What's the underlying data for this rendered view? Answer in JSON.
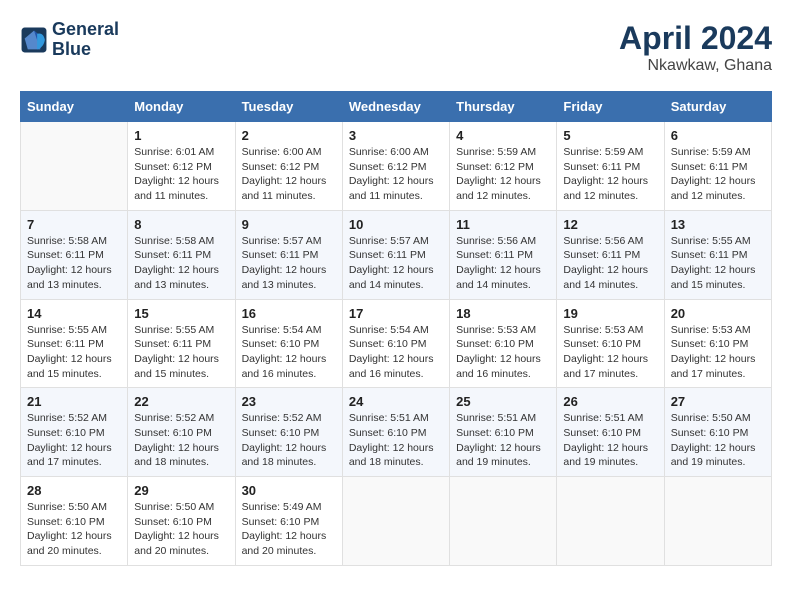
{
  "header": {
    "logo_line1": "General",
    "logo_line2": "Blue",
    "month": "April 2024",
    "location": "Nkawkaw, Ghana"
  },
  "weekdays": [
    "Sunday",
    "Monday",
    "Tuesday",
    "Wednesday",
    "Thursday",
    "Friday",
    "Saturday"
  ],
  "weeks": [
    [
      {
        "day": "",
        "sunrise": "",
        "sunset": "",
        "daylight": ""
      },
      {
        "day": "1",
        "sunrise": "Sunrise: 6:01 AM",
        "sunset": "Sunset: 6:12 PM",
        "daylight": "Daylight: 12 hours and 11 minutes."
      },
      {
        "day": "2",
        "sunrise": "Sunrise: 6:00 AM",
        "sunset": "Sunset: 6:12 PM",
        "daylight": "Daylight: 12 hours and 11 minutes."
      },
      {
        "day": "3",
        "sunrise": "Sunrise: 6:00 AM",
        "sunset": "Sunset: 6:12 PM",
        "daylight": "Daylight: 12 hours and 11 minutes."
      },
      {
        "day": "4",
        "sunrise": "Sunrise: 5:59 AM",
        "sunset": "Sunset: 6:12 PM",
        "daylight": "Daylight: 12 hours and 12 minutes."
      },
      {
        "day": "5",
        "sunrise": "Sunrise: 5:59 AM",
        "sunset": "Sunset: 6:11 PM",
        "daylight": "Daylight: 12 hours and 12 minutes."
      },
      {
        "day": "6",
        "sunrise": "Sunrise: 5:59 AM",
        "sunset": "Sunset: 6:11 PM",
        "daylight": "Daylight: 12 hours and 12 minutes."
      }
    ],
    [
      {
        "day": "7",
        "sunrise": "Sunrise: 5:58 AM",
        "sunset": "Sunset: 6:11 PM",
        "daylight": "Daylight: 12 hours and 13 minutes."
      },
      {
        "day": "8",
        "sunrise": "Sunrise: 5:58 AM",
        "sunset": "Sunset: 6:11 PM",
        "daylight": "Daylight: 12 hours and 13 minutes."
      },
      {
        "day": "9",
        "sunrise": "Sunrise: 5:57 AM",
        "sunset": "Sunset: 6:11 PM",
        "daylight": "Daylight: 12 hours and 13 minutes."
      },
      {
        "day": "10",
        "sunrise": "Sunrise: 5:57 AM",
        "sunset": "Sunset: 6:11 PM",
        "daylight": "Daylight: 12 hours and 14 minutes."
      },
      {
        "day": "11",
        "sunrise": "Sunrise: 5:56 AM",
        "sunset": "Sunset: 6:11 PM",
        "daylight": "Daylight: 12 hours and 14 minutes."
      },
      {
        "day": "12",
        "sunrise": "Sunrise: 5:56 AM",
        "sunset": "Sunset: 6:11 PM",
        "daylight": "Daylight: 12 hours and 14 minutes."
      },
      {
        "day": "13",
        "sunrise": "Sunrise: 5:55 AM",
        "sunset": "Sunset: 6:11 PM",
        "daylight": "Daylight: 12 hours and 15 minutes."
      }
    ],
    [
      {
        "day": "14",
        "sunrise": "Sunrise: 5:55 AM",
        "sunset": "Sunset: 6:11 PM",
        "daylight": "Daylight: 12 hours and 15 minutes."
      },
      {
        "day": "15",
        "sunrise": "Sunrise: 5:55 AM",
        "sunset": "Sunset: 6:11 PM",
        "daylight": "Daylight: 12 hours and 15 minutes."
      },
      {
        "day": "16",
        "sunrise": "Sunrise: 5:54 AM",
        "sunset": "Sunset: 6:10 PM",
        "daylight": "Daylight: 12 hours and 16 minutes."
      },
      {
        "day": "17",
        "sunrise": "Sunrise: 5:54 AM",
        "sunset": "Sunset: 6:10 PM",
        "daylight": "Daylight: 12 hours and 16 minutes."
      },
      {
        "day": "18",
        "sunrise": "Sunrise: 5:53 AM",
        "sunset": "Sunset: 6:10 PM",
        "daylight": "Daylight: 12 hours and 16 minutes."
      },
      {
        "day": "19",
        "sunrise": "Sunrise: 5:53 AM",
        "sunset": "Sunset: 6:10 PM",
        "daylight": "Daylight: 12 hours and 17 minutes."
      },
      {
        "day": "20",
        "sunrise": "Sunrise: 5:53 AM",
        "sunset": "Sunset: 6:10 PM",
        "daylight": "Daylight: 12 hours and 17 minutes."
      }
    ],
    [
      {
        "day": "21",
        "sunrise": "Sunrise: 5:52 AM",
        "sunset": "Sunset: 6:10 PM",
        "daylight": "Daylight: 12 hours and 17 minutes."
      },
      {
        "day": "22",
        "sunrise": "Sunrise: 5:52 AM",
        "sunset": "Sunset: 6:10 PM",
        "daylight": "Daylight: 12 hours and 18 minutes."
      },
      {
        "day": "23",
        "sunrise": "Sunrise: 5:52 AM",
        "sunset": "Sunset: 6:10 PM",
        "daylight": "Daylight: 12 hours and 18 minutes."
      },
      {
        "day": "24",
        "sunrise": "Sunrise: 5:51 AM",
        "sunset": "Sunset: 6:10 PM",
        "daylight": "Daylight: 12 hours and 18 minutes."
      },
      {
        "day": "25",
        "sunrise": "Sunrise: 5:51 AM",
        "sunset": "Sunset: 6:10 PM",
        "daylight": "Daylight: 12 hours and 19 minutes."
      },
      {
        "day": "26",
        "sunrise": "Sunrise: 5:51 AM",
        "sunset": "Sunset: 6:10 PM",
        "daylight": "Daylight: 12 hours and 19 minutes."
      },
      {
        "day": "27",
        "sunrise": "Sunrise: 5:50 AM",
        "sunset": "Sunset: 6:10 PM",
        "daylight": "Daylight: 12 hours and 19 minutes."
      }
    ],
    [
      {
        "day": "28",
        "sunrise": "Sunrise: 5:50 AM",
        "sunset": "Sunset: 6:10 PM",
        "daylight": "Daylight: 12 hours and 20 minutes."
      },
      {
        "day": "29",
        "sunrise": "Sunrise: 5:50 AM",
        "sunset": "Sunset: 6:10 PM",
        "daylight": "Daylight: 12 hours and 20 minutes."
      },
      {
        "day": "30",
        "sunrise": "Sunrise: 5:49 AM",
        "sunset": "Sunset: 6:10 PM",
        "daylight": "Daylight: 12 hours and 20 minutes."
      },
      {
        "day": "",
        "sunrise": "",
        "sunset": "",
        "daylight": ""
      },
      {
        "day": "",
        "sunrise": "",
        "sunset": "",
        "daylight": ""
      },
      {
        "day": "",
        "sunrise": "",
        "sunset": "",
        "daylight": ""
      },
      {
        "day": "",
        "sunrise": "",
        "sunset": "",
        "daylight": ""
      }
    ]
  ]
}
